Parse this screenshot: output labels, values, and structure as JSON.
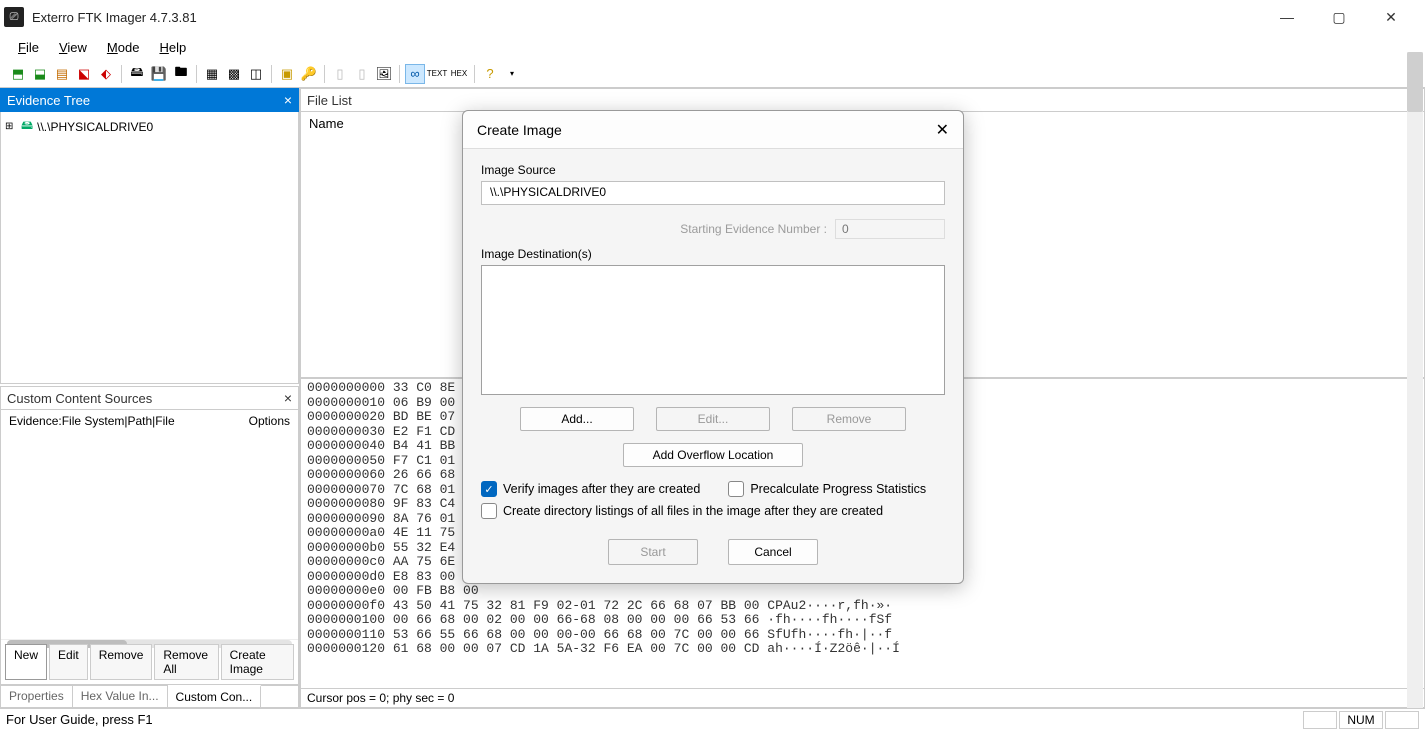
{
  "app": {
    "title": "Exterro FTK Imager 4.7.3.81"
  },
  "menus": {
    "file": "File",
    "view": "View",
    "mode": "Mode",
    "help": "Help"
  },
  "panels": {
    "evidence_tree_title": "Evidence Tree",
    "file_list_title": "File List",
    "file_list_col": "Name",
    "custom_content_title": "Custom Content Sources",
    "cc_head_left": "Evidence:File System|Path|File",
    "cc_head_right": "Options"
  },
  "tree": {
    "node0": "\\\\.\\PHYSICALDRIVE0"
  },
  "cc_buttons": {
    "new": "New",
    "edit": "Edit",
    "remove": "Remove",
    "remove_all": "Remove All",
    "create_image": "Create Image"
  },
  "bottom_tabs": {
    "properties": "Properties",
    "hex": "Hex Value In...",
    "custom": "Custom Con..."
  },
  "hex": {
    "lines": "0000000000 33 C0 8E D0\n0000000010 06 B9 00 02\n0000000020 BD BE 07 80\n0000000030 E2 F1 CD 18\n0000000040 B4 41 BB AA\n0000000050 F7 C1 01 00\n0000000060 26 66 68 00\n0000000070 7C 68 01 00\n0000000080 9F 83 C4 10\n0000000090 8A 76 01 8A\n00000000a0 4E 11 75 0C\n00000000b0 55 32 E4 8A\n00000000c0 AA 75 6E FF\n00000000d0 E8 83 00 B0\n00000000e0 00 FB B8 00\n00000000f0 43 50 41 75 32 81 F9 02-01 72 2C 66 68 07 BB 00 CPAu2····r,fh·»·\n0000000100 00 66 68 00 02 00 00 66-68 08 00 00 00 66 53 66 ·fh····fh····fSf\n0000000110 53 66 55 66 68 00 00 00-00 66 68 00 7C 00 00 66 SfUfh····fh·|··f\n0000000120 61 68 00 00 07 CD 1A 5A-32 F6 EA 00 7C 00 00 CD ah····Í·Z2öê·|··Í",
    "status": "Cursor pos = 0; phy sec = 0"
  },
  "statusbar": {
    "text": "For User Guide, press F1",
    "num": "NUM"
  },
  "dialog": {
    "title": "Create Image",
    "source_label": "Image Source",
    "source_value": "\\\\.\\PHYSICALDRIVE0",
    "start_label": "Starting Evidence Number :",
    "start_value": "0",
    "dest_label": "Image Destination(s)",
    "add": "Add...",
    "edit": "Edit...",
    "remove": "Remove",
    "overflow": "Add Overflow Location",
    "verify": "Verify images after they are created",
    "precalc": "Precalculate Progress Statistics",
    "dirlist": "Create directory listings of all files in the image after they are created",
    "start": "Start",
    "cancel": "Cancel"
  }
}
